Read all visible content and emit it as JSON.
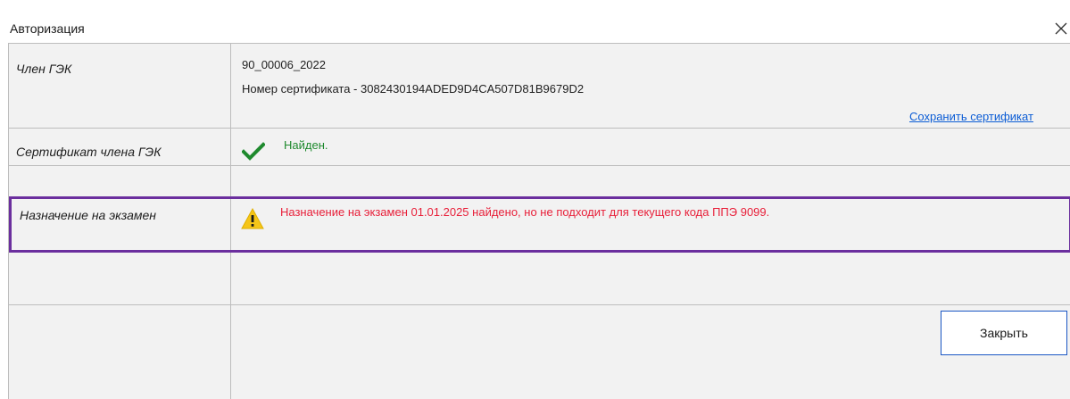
{
  "window": {
    "title": "Авторизация",
    "close_icon": "close-icon"
  },
  "rows": {
    "gek_member": {
      "label": "Член ГЭК",
      "id": "90_00006_2022",
      "cert_number": "Номер сертификата - 3082430194ADED9D4CA507D81B9679D2",
      "save_link": "Сохранить сертификат"
    },
    "certificate": {
      "label": "Сертификат члена ГЭК",
      "status_icon": "checkmark-icon",
      "status": "Найден.",
      "status_color": "#1f8a2e"
    },
    "exam_assignment": {
      "label": "Назначение на экзамен",
      "status_icon": "warning-icon",
      "message": "Назначение на экзамен 01.01.2025 найдено, но не подходит для текущего кода ППЭ 9099.",
      "message_color": "#e8203a"
    }
  },
  "actions": {
    "close_label": "Закрыть"
  },
  "colors": {
    "highlight_border": "#6b2f9e",
    "link": "#0b5cd5",
    "button_border": "#1a56c4"
  }
}
